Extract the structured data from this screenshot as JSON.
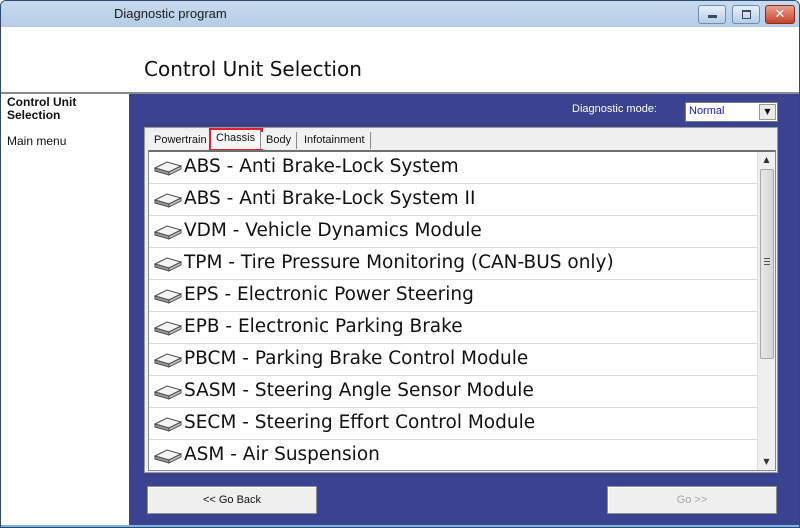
{
  "window": {
    "title": "Diagnostic program",
    "controls": {
      "minimize": "minimize",
      "maximize": "maximize",
      "close": "✕"
    }
  },
  "header": {
    "title": "Control Unit Selection"
  },
  "sidebar": {
    "current": "Control Unit Selection",
    "items": [
      {
        "label": "Main menu"
      }
    ]
  },
  "mode": {
    "label": "Diagnostic mode:",
    "value": "Normal"
  },
  "tabs": [
    {
      "label": "Powertrain",
      "active": false
    },
    {
      "label": "Chassis",
      "active": true
    },
    {
      "label": "Body",
      "active": false
    },
    {
      "label": "Infotainment",
      "active": false
    }
  ],
  "modules": [
    {
      "label": "ABS - Anti Brake-Lock System",
      "icon": "control-unit-icon"
    },
    {
      "label": "ABS - Anti Brake-Lock System II",
      "icon": "control-unit-icon"
    },
    {
      "label": "VDM - Vehicle Dynamics Module",
      "icon": "control-unit-icon"
    },
    {
      "label": "TPM - Tire Pressure Monitoring (CAN-BUS only)",
      "icon": "control-unit-icon"
    },
    {
      "label": "EPS - Electronic Power Steering",
      "icon": "control-unit-icon"
    },
    {
      "label": "EPB - Electronic Parking Brake",
      "icon": "control-unit-icon"
    },
    {
      "label": "PBCM - Parking Brake Control Module",
      "icon": "control-unit-icon"
    },
    {
      "label": "SASM - Steering Angle Sensor Module",
      "icon": "control-unit-icon"
    },
    {
      "label": "SECM - Steering Effort Control Module",
      "icon": "control-unit-icon"
    },
    {
      "label": "ASM - Air Suspension",
      "icon": "control-unit-icon"
    }
  ],
  "buttons": {
    "back": "<< Go Back",
    "go": "Go >>",
    "go_enabled": false
  },
  "scrollbar": {
    "up": "▲",
    "down": "▼"
  },
  "colors": {
    "main_panel": "#39438f",
    "active_tab_highlight": "#e0202c",
    "mode_value_text": "#1a1adb"
  }
}
